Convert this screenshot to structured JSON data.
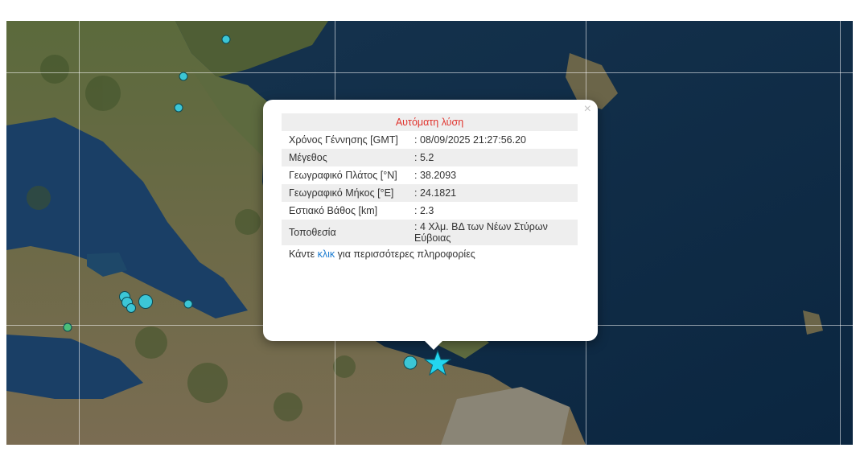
{
  "popup": {
    "title": "Αυτόματη λύση",
    "close_symbol": "×",
    "rows": [
      {
        "label": "Χρόνος Γέννησης [GMT]",
        "value": ": 08/09/2025 21:27:56.20"
      },
      {
        "label": "Μέγεθος",
        "value": ": 5.2"
      },
      {
        "label": "Γεωγραφικό Πλάτος [°N]",
        "value": ": 38.2093"
      },
      {
        "label": "Γεωγραφικό Μήκος [°E]",
        "value": ": 24.1821"
      },
      {
        "label": "Εστιακό Βάθος [km]",
        "value": ": 2.3"
      },
      {
        "label": "Τοποθεσία",
        "value": ": 4 Χλμ. ΒΔ των Νέων Στύρων Εύβοιας"
      }
    ],
    "more_prefix": "Κάντε ",
    "more_link": "κλικ",
    "more_suffix": " για περισσότερες πληροφορίες"
  },
  "markers": {
    "event_color": "#3cc6d6",
    "main_event_icon": "star-icon",
    "main_event_color": "#23d6ef"
  }
}
